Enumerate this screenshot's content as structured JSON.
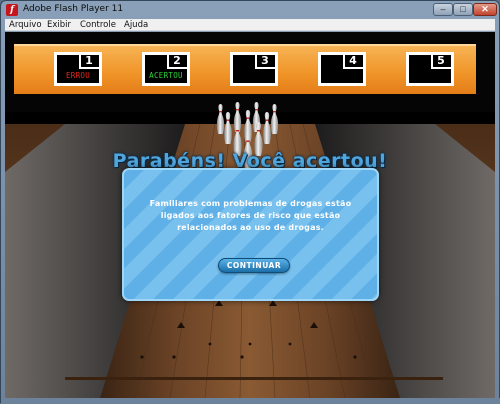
{
  "window": {
    "title": "Adobe Flash Player 11",
    "app_icon_glyph": "f",
    "min_glyph": "–",
    "max_glyph": "□",
    "close_glyph": "✕"
  },
  "menu": [
    {
      "label": "Arquivo"
    },
    {
      "label": "Exibir"
    },
    {
      "label": "Controle"
    },
    {
      "label": "Ajuda"
    }
  ],
  "scoreboard": {
    "frames": [
      {
        "number": "1",
        "status": "ERROU",
        "status_color": "#e8261c"
      },
      {
        "number": "2",
        "status": "ACERTOU",
        "status_color": "#2fd33c"
      },
      {
        "number": "3",
        "status": "",
        "status_color": "#ffffff"
      },
      {
        "number": "4",
        "status": "",
        "status_color": "#ffffff"
      },
      {
        "number": "5",
        "status": "",
        "status_color": "#ffffff"
      }
    ]
  },
  "result": {
    "headline": "Parabéns! Você acertou!",
    "message": "Familiares com problemas de drogas estão ligados aos fatores de risco que estão relacionados ao uso de drogas.",
    "continue_label": "CONTINUAR"
  },
  "colors": {
    "board_orange": "#f0962a",
    "modal_blue": "#5fb0e6",
    "headline_blue": "#4fa6dd"
  }
}
